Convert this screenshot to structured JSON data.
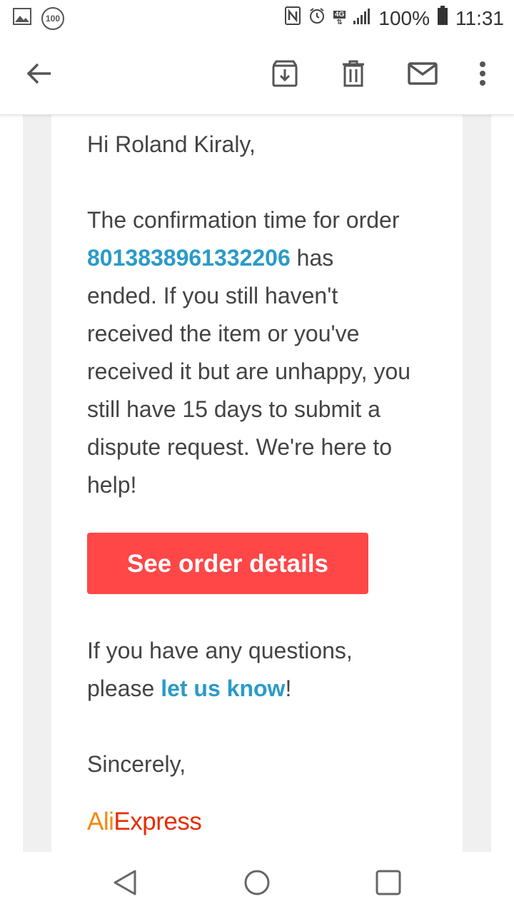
{
  "status_bar": {
    "notification_badge": "100",
    "battery_percent": "100%",
    "time": "11:31",
    "network": "4G"
  },
  "toolbar": {
    "icons": [
      "back-arrow-icon",
      "archive-icon",
      "delete-icon",
      "mark-unread-icon",
      "more-vert-icon"
    ]
  },
  "email": {
    "greeting": "Hi Roland Kiraly,",
    "message": {
      "line1": "The confirmation time for order",
      "order_number": "8013838961332206",
      "line2_rest": " has",
      "line3": "ended. If you still haven't",
      "line4": "received the item or you've",
      "line5": "received it but are unhappy, you",
      "line6": "still have 15 days to submit a",
      "line7": "dispute request. We're here to",
      "line8": "help!"
    },
    "cta_label": "See order details",
    "questions": {
      "line1": "If you have any questions,",
      "prefix": "please ",
      "link": "let us know",
      "suffix": "!"
    },
    "closing": "Sincerely,",
    "signature": {
      "part1": "Ali",
      "part2": "Express"
    }
  },
  "colors": {
    "link": "#2a9bc7",
    "cta": "#ff4747",
    "text": "#444444",
    "logo_orange": "#f08a0f",
    "logo_red": "#e62e04"
  },
  "nav_bar": {
    "icons": [
      "back-nav-icon",
      "home-nav-icon",
      "recents-nav-icon"
    ]
  }
}
